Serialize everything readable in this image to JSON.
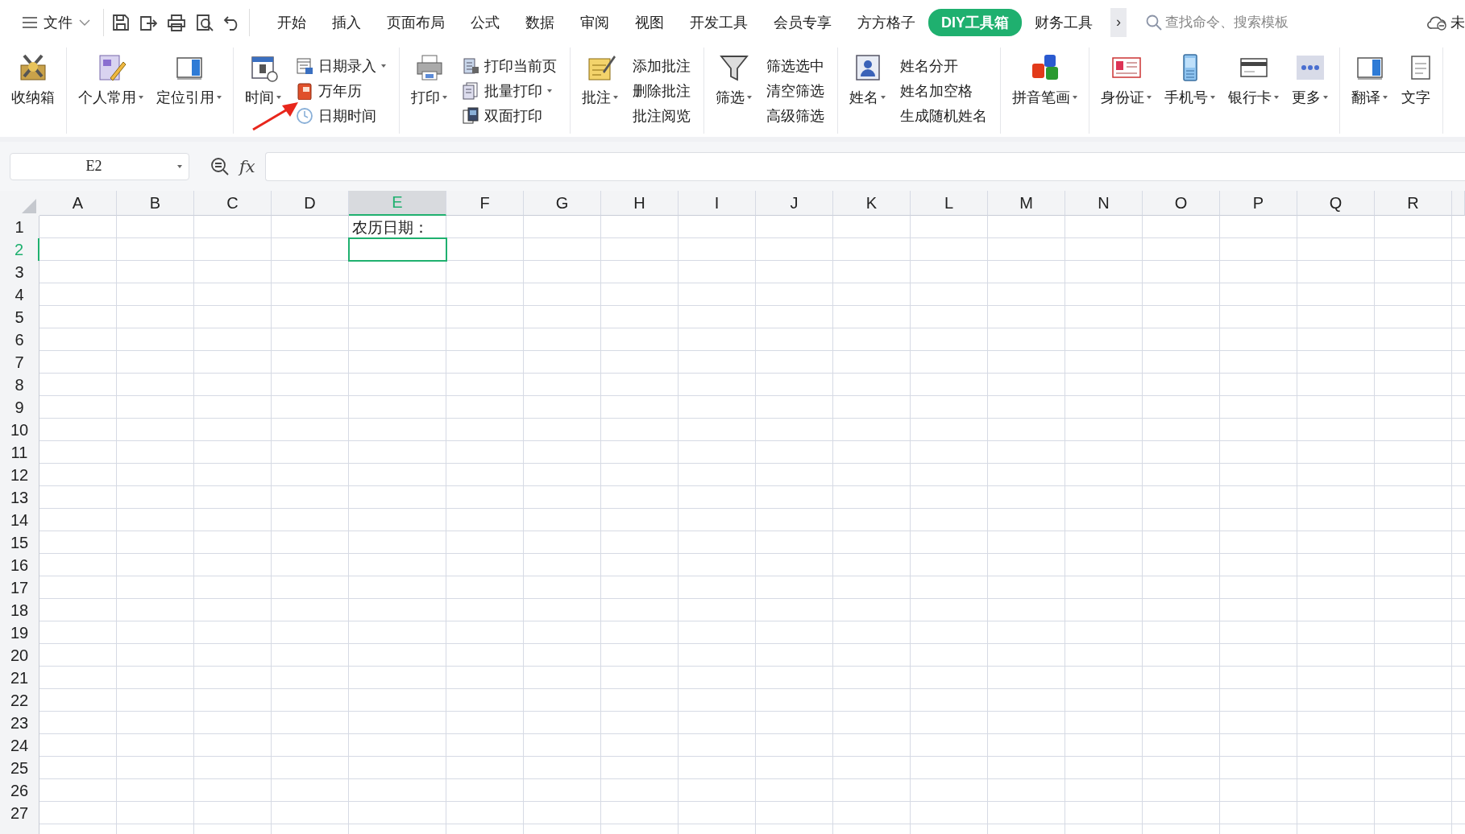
{
  "menu_bar": {
    "file_menu": "文件",
    "tabs": [
      {
        "label": "开始",
        "selected": false
      },
      {
        "label": "插入",
        "selected": false
      },
      {
        "label": "页面布局",
        "selected": false
      },
      {
        "label": "公式",
        "selected": false
      },
      {
        "label": "数据",
        "selected": false
      },
      {
        "label": "审阅",
        "selected": false
      },
      {
        "label": "视图",
        "selected": false
      },
      {
        "label": "开发工具",
        "selected": false
      },
      {
        "label": "会员专享",
        "selected": false
      },
      {
        "label": "方方格子",
        "selected": false
      },
      {
        "label": "DIY工具箱",
        "selected": true
      },
      {
        "label": "财务工具",
        "selected": false
      }
    ],
    "more_tabs": "›",
    "search": {
      "placeholder": "查找命令、搜索模板"
    },
    "cloud_status": "未"
  },
  "ribbon": {
    "groups": [
      {
        "items": [
          {
            "kind": "large",
            "label": "收纳箱",
            "dropdown": false
          }
        ]
      },
      {
        "items": [
          {
            "kind": "large",
            "label": "个人常用",
            "dropdown": true
          },
          {
            "kind": "large",
            "label": "定位引用",
            "dropdown": true
          }
        ]
      },
      {
        "items": [
          {
            "kind": "large",
            "label": "时间",
            "dropdown": true
          },
          {
            "kind": "small",
            "label": "日期录入",
            "dropdown": true
          },
          {
            "kind": "small",
            "label": "万年历",
            "dropdown": false
          },
          {
            "kind": "small",
            "label": "日期时间",
            "dropdown": false
          }
        ]
      },
      {
        "items": [
          {
            "kind": "large",
            "label": "打印",
            "dropdown": true
          },
          {
            "kind": "small",
            "label": "打印当前页",
            "dropdown": false
          },
          {
            "kind": "small",
            "label": "批量打印",
            "dropdown": true
          },
          {
            "kind": "small",
            "label": "双面打印",
            "dropdown": false
          }
        ]
      },
      {
        "items": [
          {
            "kind": "large",
            "label": "批注",
            "dropdown": true
          },
          {
            "kind": "text",
            "label": "添加批注",
            "dropdown": false
          },
          {
            "kind": "text",
            "label": "删除批注",
            "dropdown": false
          },
          {
            "kind": "text",
            "label": "批注阅览",
            "dropdown": false
          }
        ]
      },
      {
        "items": [
          {
            "kind": "large",
            "label": "筛选",
            "dropdown": true
          },
          {
            "kind": "text",
            "label": "筛选选中",
            "dropdown": false
          },
          {
            "kind": "text",
            "label": "清空筛选",
            "dropdown": false
          },
          {
            "kind": "text",
            "label": "高级筛选",
            "dropdown": false
          }
        ]
      },
      {
        "items": [
          {
            "kind": "large",
            "label": "姓名",
            "dropdown": true
          },
          {
            "kind": "text",
            "label": "姓名分开",
            "dropdown": false
          },
          {
            "kind": "text",
            "label": "姓名加空格",
            "dropdown": false
          },
          {
            "kind": "text",
            "label": "生成随机姓名",
            "dropdown": false
          }
        ]
      },
      {
        "items": [
          {
            "kind": "large",
            "label": "拼音笔画",
            "dropdown": true
          }
        ]
      },
      {
        "items": [
          {
            "kind": "large",
            "label": "身份证",
            "dropdown": true
          },
          {
            "kind": "large",
            "label": "手机号",
            "dropdown": true
          },
          {
            "kind": "large",
            "label": "银行卡",
            "dropdown": true
          },
          {
            "kind": "large",
            "label": "更多",
            "dropdown": true
          }
        ]
      },
      {
        "items": [
          {
            "kind": "large",
            "label": "翻译",
            "dropdown": true
          },
          {
            "kind": "large",
            "label": "文字",
            "dropdown": false
          }
        ]
      }
    ]
  },
  "formula_bar": {
    "name_box": "E2",
    "function_label": "fx"
  },
  "sheet": {
    "columns": [
      {
        "label": "A",
        "selected": false
      },
      {
        "label": "B",
        "selected": false
      },
      {
        "label": "C",
        "selected": false
      },
      {
        "label": "D",
        "selected": false
      },
      {
        "label": "E",
        "selected": true,
        "cells": [
          "农历日期："
        ]
      },
      {
        "label": "F",
        "selected": false
      },
      {
        "label": "G",
        "selected": false
      },
      {
        "label": "H",
        "selected": false
      },
      {
        "label": "I",
        "selected": false
      },
      {
        "label": "J",
        "selected": false
      },
      {
        "label": "K",
        "selected": false
      },
      {
        "label": "L",
        "selected": false
      },
      {
        "label": "M",
        "selected": false
      },
      {
        "label": "N",
        "selected": false
      },
      {
        "label": "O",
        "selected": false
      },
      {
        "label": "P",
        "selected": false
      },
      {
        "label": "Q",
        "selected": false
      },
      {
        "label": "R",
        "selected": false
      }
    ],
    "rows": [
      {
        "label": "1",
        "selected": false
      },
      {
        "label": "2",
        "selected": true
      },
      {
        "label": "3",
        "selected": false
      },
      {
        "label": "4",
        "selected": false
      },
      {
        "label": "5",
        "selected": false
      },
      {
        "label": "6",
        "selected": false
      },
      {
        "label": "7",
        "selected": false
      },
      {
        "label": "8",
        "selected": false
      },
      {
        "label": "9",
        "selected": false
      },
      {
        "label": "10",
        "selected": false
      },
      {
        "label": "11",
        "selected": false
      },
      {
        "label": "12",
        "selected": false
      },
      {
        "label": "13",
        "selected": false
      },
      {
        "label": "14",
        "selected": false
      },
      {
        "label": "15",
        "selected": false
      },
      {
        "label": "16",
        "selected": false
      },
      {
        "label": "17",
        "selected": false
      },
      {
        "label": "18",
        "selected": false
      },
      {
        "label": "19",
        "selected": false
      },
      {
        "label": "20",
        "selected": false
      },
      {
        "label": "21",
        "selected": false
      },
      {
        "label": "22",
        "selected": false
      },
      {
        "label": "23",
        "selected": false
      },
      {
        "label": "24",
        "selected": false
      },
      {
        "label": "25",
        "selected": false
      },
      {
        "label": "26",
        "selected": false
      },
      {
        "label": "27",
        "selected": false
      }
    ]
  }
}
